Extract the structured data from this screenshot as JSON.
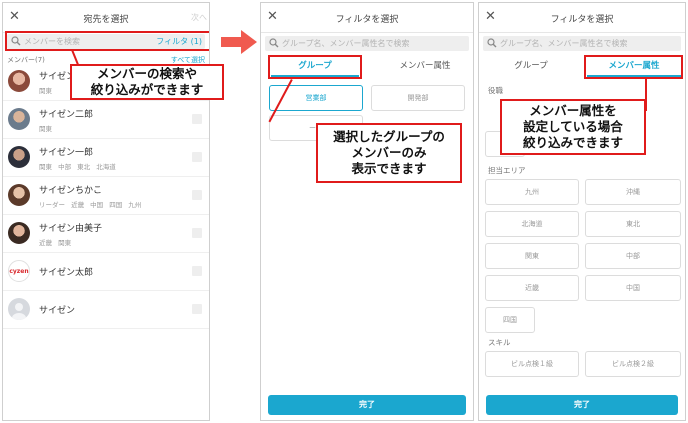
{
  "screen1": {
    "close": "✕",
    "title": "宛先を選択",
    "right_label": "次へ",
    "search_placeholder": "メンバーを検索",
    "filter_label": "フィルタ (1)",
    "members_label": "メンバー(7)",
    "select_all": "すべて選択",
    "members": [
      {
        "name": "サイゼン",
        "tags": "関東"
      },
      {
        "name": "サイゼン二郎",
        "tags": "関東"
      },
      {
        "name": "サイゼン一郎",
        "tags": "関東 中部 東北 北海道"
      },
      {
        "name": "サイゼンちかこ",
        "tags": "リーダー 近畿 中国 四国 九州"
      },
      {
        "name": "サイゼン由美子",
        "tags": "近畿 関東"
      },
      {
        "name": "サイゼン太郎",
        "tags": ""
      },
      {
        "name": "サイゼン",
        "tags": ""
      }
    ],
    "logo_text": "cyzen",
    "callout": "メンバーの検索や\n絞り込みができます"
  },
  "screen2": {
    "close": "✕",
    "title": "フィルタを選択",
    "search_placeholder": "グループ名、メンバー属性名で検索",
    "tab_group": "グループ",
    "tab_attr": "メンバー属性",
    "chips": [
      "営業部",
      "開発部",
      "ーク"
    ],
    "callout": "選択したグループの\nメンバーのみ\n表示できます",
    "done": "完了"
  },
  "screen3": {
    "close": "✕",
    "title": "フィルタを選択",
    "search_placeholder": "グループ名、メンバー属性名で検索",
    "tab_group": "グループ",
    "tab_attr": "メンバー属性",
    "section_role": "役職",
    "section_area": "担当エリア",
    "areas": [
      "九州",
      "沖縄",
      "北海道",
      "東北",
      "関東",
      "中部",
      "近畿",
      "中国",
      "四国"
    ],
    "section_skill": "スキル",
    "skills": [
      "ビル点検１級",
      "ビル点検２級"
    ],
    "callout": "メンバー属性を\n設定している場合\n絞り込みできます",
    "done": "完了"
  },
  "colors": {
    "accent": "#1ba7cf",
    "annotation": "#e01b1b",
    "arrow": "#f05a4f"
  },
  "icons": {
    "close": "close-icon",
    "search": "search-icon",
    "arrow": "right-arrow-icon"
  }
}
